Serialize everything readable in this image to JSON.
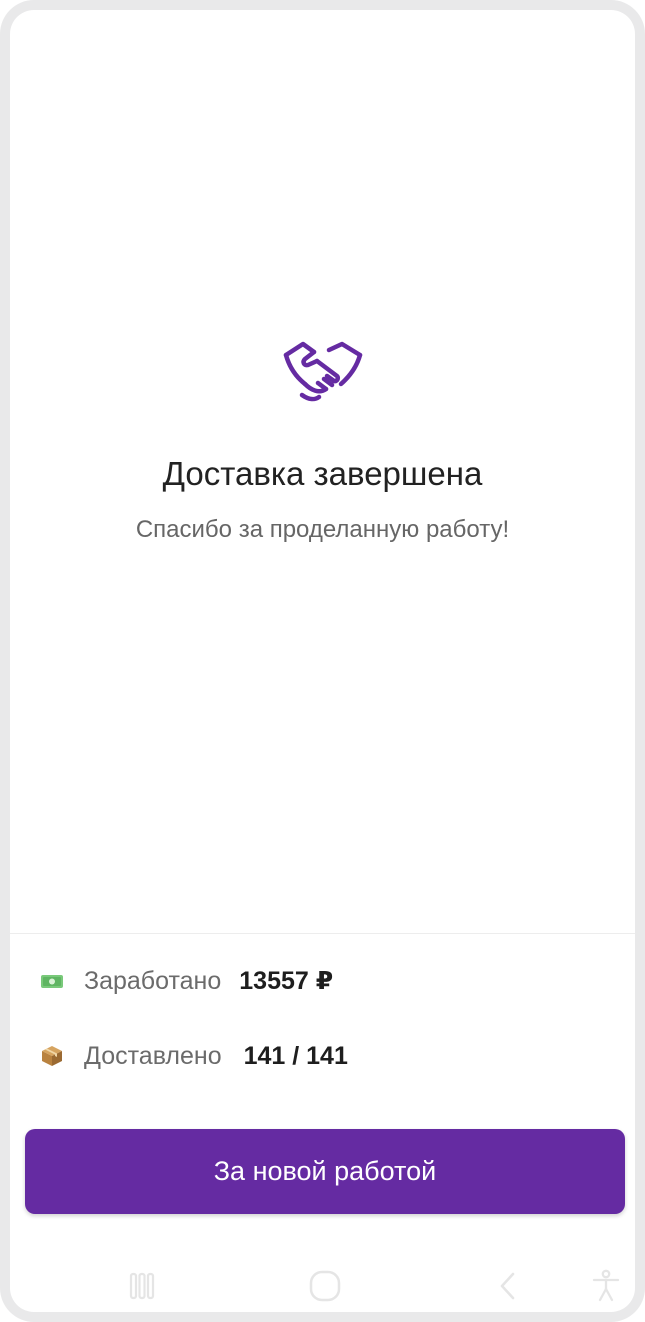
{
  "colors": {
    "accent": "#652ba2",
    "title": "#222222",
    "subtitle": "#666666",
    "label": "#6b6b6b",
    "value": "#1e1e1e"
  },
  "success": {
    "icon": "handshake-icon",
    "title": "Доставка завершена",
    "subtitle": "Спасибо за проделанную работу!"
  },
  "summary": {
    "earned": {
      "icon": "money-icon",
      "label": "Заработано",
      "value": "13557 ₽"
    },
    "delivered": {
      "icon": "package-icon",
      "label": "Доставлено",
      "value": "141 / 141"
    }
  },
  "actions": {
    "primary_label": "За новой работой"
  },
  "navbar": {
    "items": [
      "recent-apps-icon",
      "home-icon",
      "back-icon",
      "accessibility-icon"
    ]
  }
}
